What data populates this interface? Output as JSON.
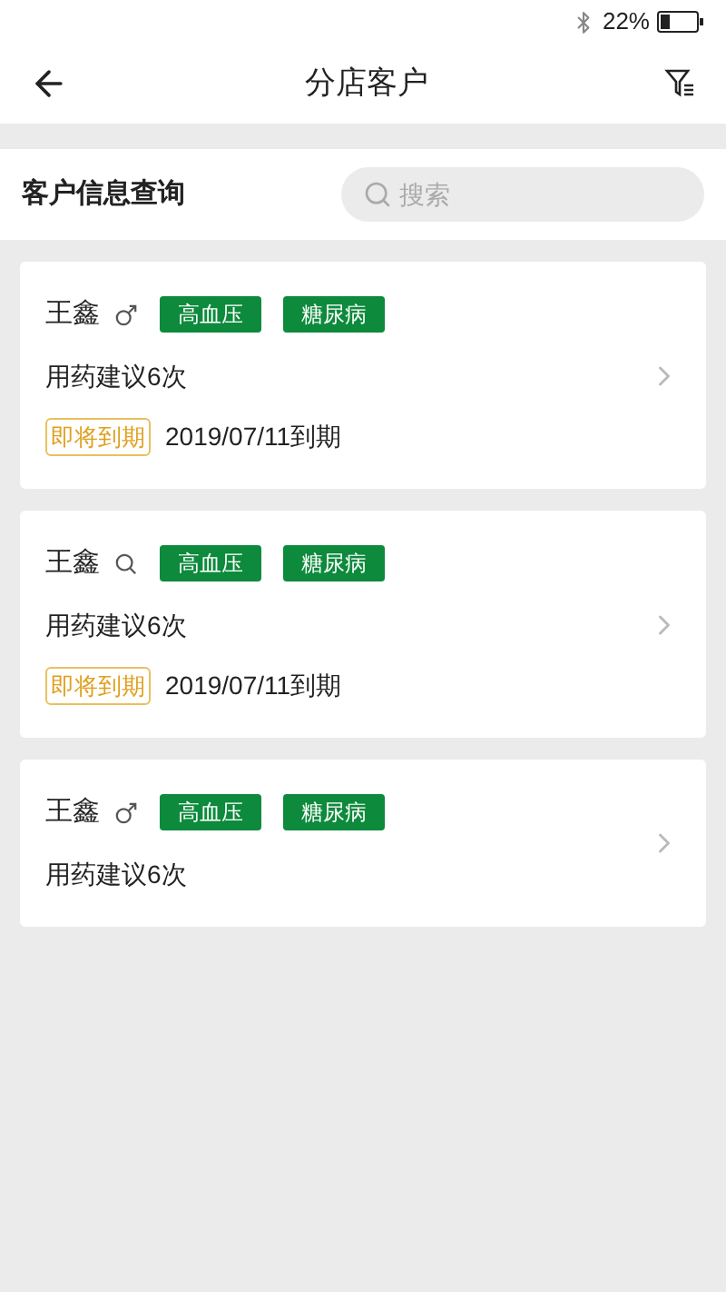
{
  "status_bar": {
    "battery": "22%"
  },
  "header": {
    "title": "分店客户"
  },
  "search_section": {
    "title": "客户信息查询",
    "placeholder": "搜索"
  },
  "customers": [
    {
      "name": "王鑫",
      "kind": "male",
      "tags": [
        "高血压",
        "糖尿病"
      ],
      "advice": "用药建议6次",
      "expiry": {
        "label": "即将到期",
        "date": "2019/07/11到期"
      }
    },
    {
      "name": "王鑫",
      "kind": "magnifier",
      "tags": [
        "高血压",
        "糖尿病"
      ],
      "advice": "用药建议6次",
      "expiry": {
        "label": "即将到期",
        "date": "2019/07/11到期"
      }
    },
    {
      "name": "王鑫",
      "kind": "male",
      "tags": [
        "高血压",
        "糖尿病"
      ],
      "advice": "用药建议6次"
    }
  ]
}
